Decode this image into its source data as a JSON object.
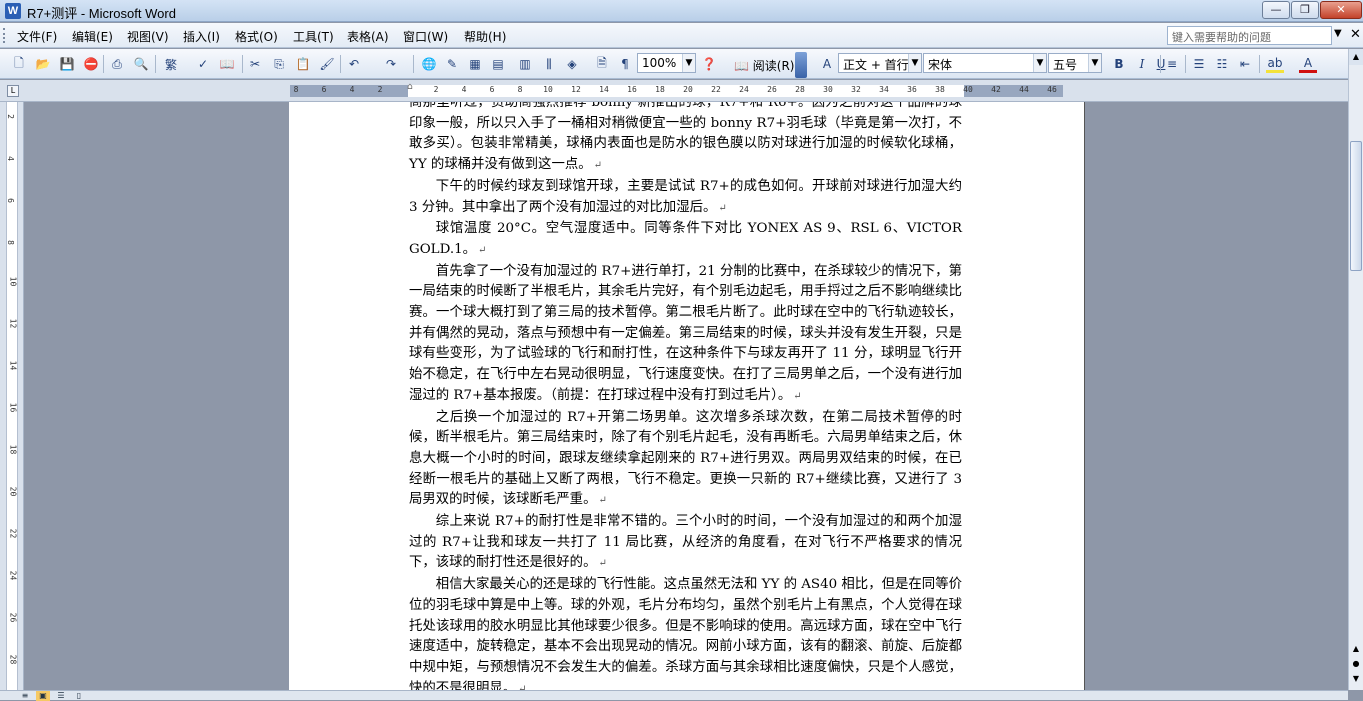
{
  "window": {
    "title": "R7+测评 - Microsoft Word",
    "minimize_glyph": "—",
    "restore_glyph": "❐",
    "close_glyph": "✕"
  },
  "menu": {
    "items": [
      "文件(F)",
      "编辑(E)",
      "视图(V)",
      "插入(I)",
      "格式(O)",
      "工具(T)",
      "表格(A)",
      "窗口(W)",
      "帮助(H)"
    ],
    "help_placeholder": "键入需要帮助的问题"
  },
  "toolbar": {
    "zoom": "100%",
    "reading_label": "阅读(R)",
    "style": "正文 + 首行",
    "font": "宋体",
    "size": "五号",
    "icons": [
      "new-icon",
      "open-icon",
      "save-icon",
      "permission-icon",
      "print-icon",
      "print-preview-icon",
      "research-icon",
      "spelling-icon",
      "cut-icon",
      "copy-icon",
      "paste-icon",
      "format-painter-icon",
      "undo-icon",
      "redo-icon",
      "hyperlink-icon",
      "tables-borders-icon",
      "insert-table-icon",
      "insert-excel-icon",
      "columns-icon",
      "drawing-icon",
      "document-map-icon",
      "show-hide-icon",
      "help-icon",
      "bold-icon",
      "italic-icon",
      "underline-icon",
      "align-icon",
      "numbering-icon",
      "bullets-icon",
      "outdent-icon",
      "highlight-icon",
      "font-color-icon"
    ]
  },
  "ruler": {
    "horizontal_ticks": [
      "8",
      "6",
      "4",
      "2",
      "2",
      "4",
      "6",
      "8",
      "10",
      "12",
      "14",
      "16",
      "18",
      "20",
      "22",
      "24",
      "26",
      "28",
      "30",
      "32",
      "34",
      "36",
      "38",
      "40",
      "42",
      "44",
      "46",
      "48"
    ],
    "vertical_ticks": [
      "2",
      "4",
      "6",
      "8",
      "10",
      "12",
      "14",
      "16",
      "18",
      "20",
      "22",
      "24",
      "26",
      "28"
    ]
  },
  "document": {
    "paragraphs": [
      "商那里听过，资助商强烈推荐 bonny 新推出的球，R7+和 R6+。因为之前对这个品牌的球印象一般，所以只入手了一桶相对稍微便宜一些的 bonny R7+羽毛球（毕竟是第一次打，不敢多买）。包装非常精美，球桶内表面也是防水的银色膜以防对球进行加湿的时候软化球桶，YY 的球桶并没有做到这一点。",
      "下午的时候约球友到球馆开球，主要是试试 R7+的成色如何。开球前对球进行加湿大约 3 分钟。其中拿出了两个没有加湿过的对比加湿后。",
      "球馆温度 20°C。空气湿度适中。同等条件下对比 YONEX AS 9、RSL 6、VICTOR GOLD.1。",
      "首先拿了一个没有加湿过的 R7+进行单打，21 分制的比赛中，在杀球较少的情况下，第一局结束的时候断了半根毛片，其余毛片完好，有个别毛边起毛，用手捋过之后不影响继续比赛。一个球大概打到了第三局的技术暂停。第二根毛片断了。此时球在空中的飞行轨迹较长，并有偶然的晃动，落点与预想中有一定偏差。第三局结束的时候，球头并没有发生开裂，只是球有些变形，为了试验球的飞行和耐打性，在这种条件下与球友再开了 11 分，球明显飞行开始不稳定，在飞行中左右晃动很明显，飞行速度变快。在打了三局男单之后，一个没有进行加湿过的 R7+基本报废。（前提：在打球过程中没有打到过毛片）。",
      "之后换一个加湿过的 R7+开第二场男单。这次增多杀球次数，在第二局技术暂停的时候，断半根毛片。第三局结束时，除了有个别毛片起毛，没有再断毛。六局男单结束之后，休息大概一个小时的时间，跟球友继续拿起刚来的 R7+进行男双。两局男双结束的时候，在已经断一根毛片的基础上又断了两根，飞行不稳定。更换一只新的 R7+继续比赛，又进行了 3 局男双的时候，该球断毛严重。",
      "综上来说 R7+的耐打性是非常不错的。三个小时的时间，一个没有加湿过的和两个加湿过的 R7+让我和球友一共打了 11 局比赛，从经济的角度看，在对飞行不严格要求的情况下，该球的耐打性还是很好的。",
      "相信大家最关心的还是球的飞行性能。这点虽然无法和 YY 的 AS40 相比，但是在同等价位的羽毛球中算是中上等。球的外观，毛片分布均匀，虽然个别毛片上有黑点，个人觉得在球托处该球用的胶水明显比其他球要少很多。但是不影响球的使用。高远球方面，球在空中飞行速度适中，旋转稳定，基本不会出现晃动的情况。网前小球方面，该有的翻滚、前旋、后旋都中规中矩，与预想情况不会发生大的偏差。杀球方面与其余球相比速度偏快，只是个人感觉，快的不是很明显。"
    ],
    "paragraph_mark": "↵"
  }
}
